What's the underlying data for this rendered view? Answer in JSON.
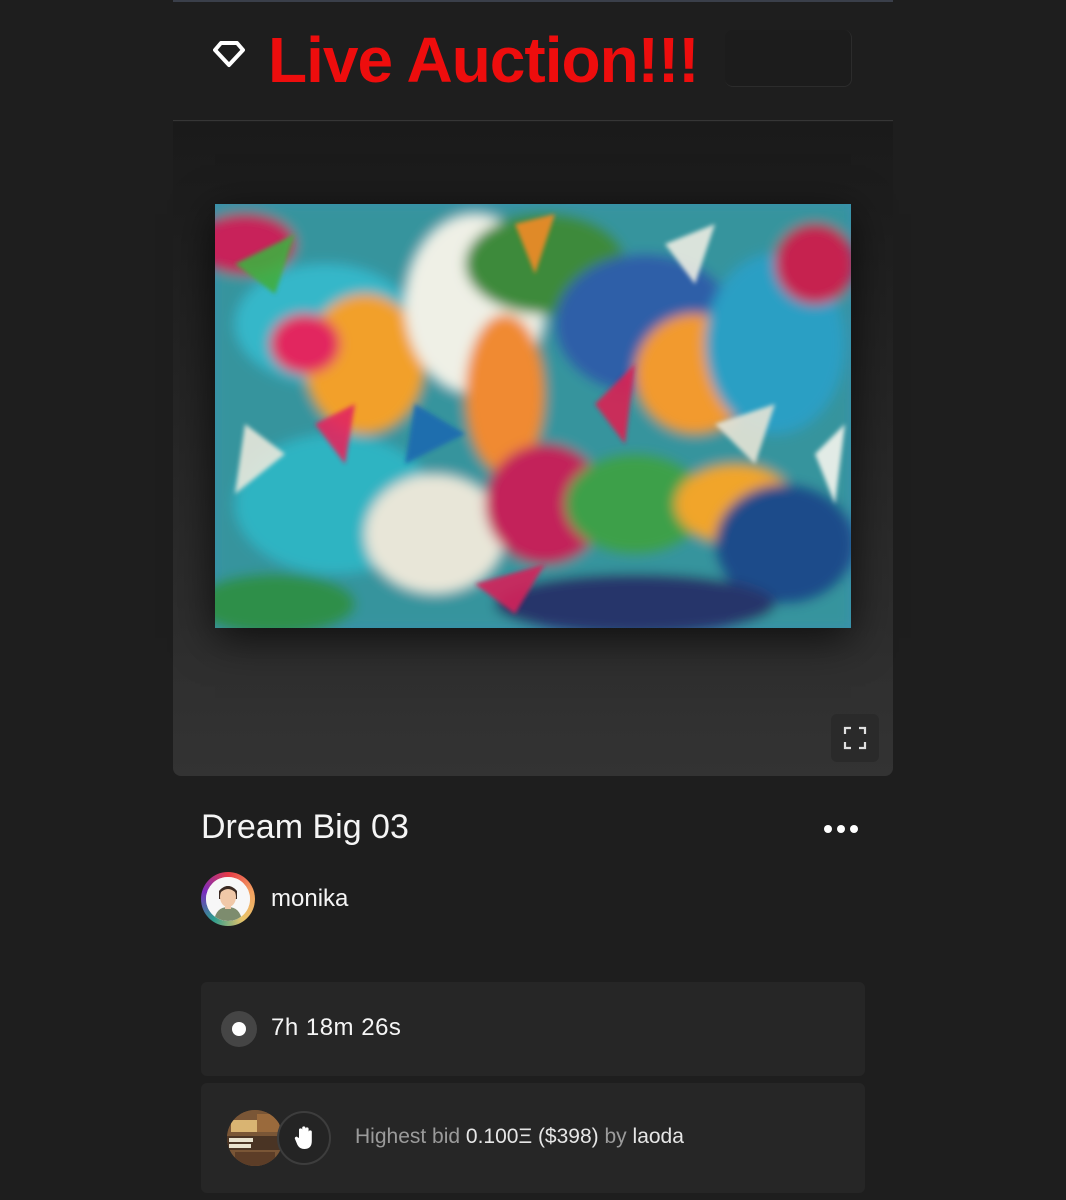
{
  "header": {
    "title": "Live Auction!!!",
    "title_color": "#ee0d0d"
  },
  "icons": {
    "logo": "diamond-icon",
    "fullscreen": "fullscreen-icon",
    "more": "more-horizontal-icon",
    "live": "live-dot-icon",
    "bid": "hand-icon"
  },
  "artwork": {
    "title": "Dream Big 03"
  },
  "artist": {
    "name": "monika"
  },
  "auction": {
    "time_remaining": "7h 18m 26s",
    "bid_label": "Highest bid",
    "bid_amount": "0.100Ξ ($398)",
    "by_label": "by",
    "bidder": "laoda"
  }
}
